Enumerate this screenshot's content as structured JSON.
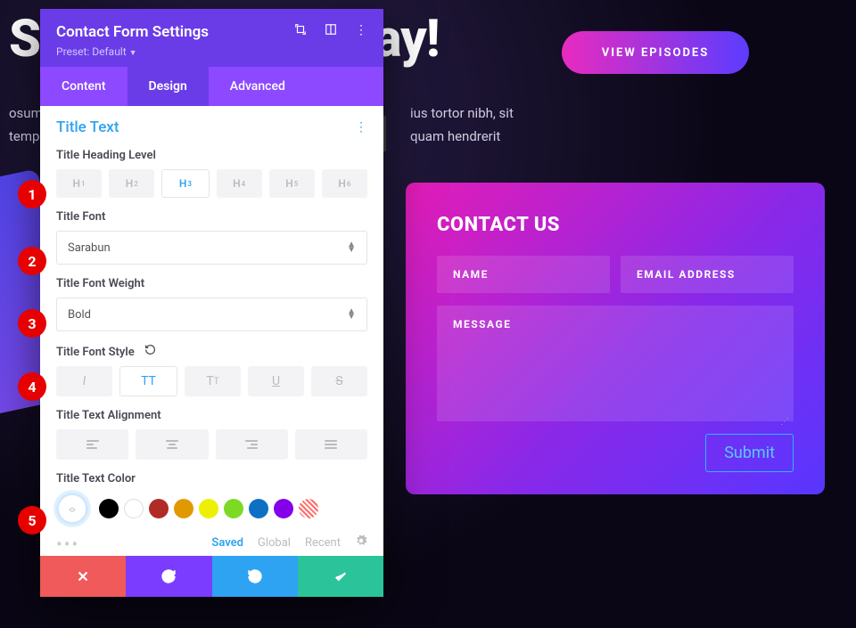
{
  "bg": {
    "title_left": "St",
    "title_right": "lay!",
    "text_left": "osum",
    "text_left2": "temp",
    "text_right": "ius tortor nibh, sit",
    "text_right2": "quam hendrerit",
    "cta": "VIEW EPISODES"
  },
  "contact": {
    "title": "CONTACT US",
    "name": "NAME",
    "email": "EMAIL ADDRESS",
    "message": "MESSAGE",
    "submit": "Submit"
  },
  "panel": {
    "title": "Contact Form Settings",
    "preset": "Preset: Default",
    "tabs": {
      "content": "Content",
      "design": "Design",
      "advanced": "Advanced"
    },
    "section": "Title Text",
    "labels": {
      "heading_level": "Title Heading Level",
      "font": "Title Font",
      "font_weight": "Title Font Weight",
      "font_style": "Title Font Style",
      "alignment": "Title Text Alignment",
      "text_color": "Title Text Color"
    },
    "heading_levels": [
      "1",
      "2",
      "3",
      "4",
      "5",
      "6"
    ],
    "heading_active": "3",
    "font_value": "Sarabun",
    "weight_value": "Bold",
    "color_tabs": {
      "saved": "Saved",
      "global": "Global",
      "recent": "Recent"
    },
    "colors": [
      "#000000",
      "#ffffff",
      "#b02b27",
      "#e09900",
      "#edf000",
      "#7cda24",
      "#0c71c3",
      "#8300e9"
    ]
  },
  "markers": [
    "1",
    "2",
    "3",
    "4",
    "5"
  ]
}
